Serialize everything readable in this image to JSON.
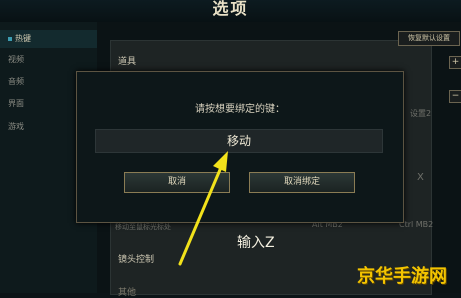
{
  "window": {
    "title": "选项"
  },
  "sidebar": {
    "items": [
      {
        "label": "热键"
      },
      {
        "label": "视频"
      },
      {
        "label": "音频"
      },
      {
        "label": "界面"
      },
      {
        "label": "游戏"
      }
    ]
  },
  "settings": {
    "reset_label": "恢复默认设置",
    "section_items": "道具",
    "section_camera": "镜头控制",
    "section_bottom": "其他",
    "column_slot2": "设置2",
    "x_value": "X",
    "move_command_label": "移动至鼠标光标处",
    "alt_mb2": "Alt MB2",
    "ctrl_mb2": "Ctrl MB2",
    "plus": "+",
    "minus": "−"
  },
  "dialog": {
    "prompt": "请按想要绑定的键：",
    "field_value": "移动",
    "cancel_label": "取消",
    "unbind_label": "取消绑定"
  },
  "annotation": {
    "text": "输入Z",
    "color": "#f2e21b"
  },
  "watermark": {
    "text": "京华手游网"
  }
}
